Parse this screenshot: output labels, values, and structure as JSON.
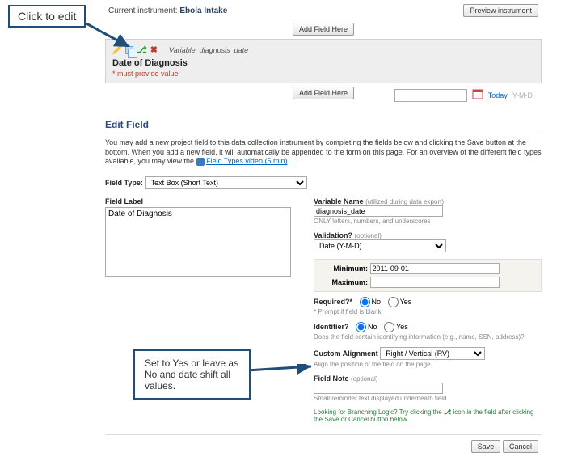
{
  "callouts": {
    "top": "Click to edit",
    "bottom": "Set to Yes or leave as No and date shift all values."
  },
  "header": {
    "current_label": "Current instrument:",
    "current_value": "Ebola Intake",
    "preview_btn": "Preview instrument"
  },
  "add_field_btn": "Add Field Here",
  "field_block": {
    "variable_prefix": "Variable:",
    "variable_name": "diagnosis_date",
    "label": "Date of Diagnosis",
    "must_provide": "* must provide value",
    "today": "Today",
    "date_hint": "Y-M-D"
  },
  "panel": {
    "title": "Edit Field",
    "desc_1": "You may add a new project field to this data collection instrument by completing the fields below and clicking the Save button at the bottom. When you add a new field, it will automatically be appended to the form on this page. For an overview of the different field types available, you may view the ",
    "desc_link": "Field Types video (5 min)",
    "field_type_label": "Field Type:",
    "field_type_value": "Text Box (Short Text)",
    "field_label_label": "Field Label",
    "field_label_value": "Date of Diagnosis",
    "var_name_label": "Variable Name",
    "var_name_hint": "(utilized during data export)",
    "var_name_value": "diagnosis_date",
    "var_name_note": "ONLY letters, numbers, and underscores",
    "validation_label": "Validation?",
    "validation_hint": "(optional)",
    "validation_value": "Date (Y-M-D)",
    "min_label": "Minimum:",
    "min_value": "2011-09-01",
    "max_label": "Maximum:",
    "required_label": "Required?*",
    "no": "No",
    "yes": "Yes",
    "required_note": "* Prompt if field is blank",
    "identifier_label": "Identifier?",
    "identifier_note": "Does the field contain identifying information (e.g., name, SSN, address)?",
    "align_label": "Custom Alignment",
    "align_value": "Right / Vertical (RV)",
    "align_note": "Align the position of the field on the page",
    "field_note_label": "Field Note",
    "field_note_hint": "(optional)",
    "field_note_note": "Small reminder text displayed underneath field",
    "branching_text": "Looking for Branching Logic? Try clicking the ",
    "branching_text2": " icon in the field after clicking the Save or Cancel button below.",
    "save": "Save",
    "cancel": "Cancel"
  }
}
